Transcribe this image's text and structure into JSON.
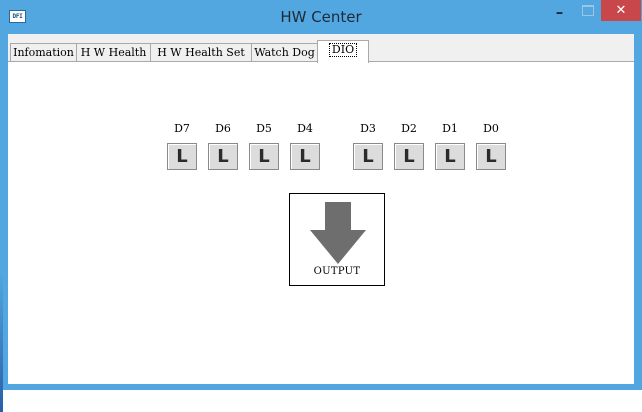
{
  "window": {
    "title": "HW Center",
    "app_icon_text": "DFI",
    "minimize_label": "–",
    "close_label": "✕"
  },
  "tabs": [
    {
      "label": "Infomation",
      "selected": false
    },
    {
      "label": "H W Health",
      "selected": false
    },
    {
      "label": "H W Health Set",
      "selected": false
    },
    {
      "label": "Watch Dog",
      "selected": false
    },
    {
      "label": "DIO",
      "selected": true
    }
  ],
  "dio": {
    "bits": [
      {
        "name": "D7",
        "state": "L"
      },
      {
        "name": "D6",
        "state": "L"
      },
      {
        "name": "D5",
        "state": "L"
      },
      {
        "name": "D4",
        "state": "L"
      },
      {
        "name": "D3",
        "state": "L"
      },
      {
        "name": "D2",
        "state": "L"
      },
      {
        "name": "D1",
        "state": "L"
      },
      {
        "name": "D0",
        "state": "L"
      }
    ],
    "output_label": "OUTPUT",
    "output_icon": "arrow-down-icon"
  },
  "colors": {
    "titlebar": "#52a7e0",
    "close_button": "#c8474a",
    "bit_button": "#dcdcdc",
    "arrow": "#6e6e6e"
  }
}
